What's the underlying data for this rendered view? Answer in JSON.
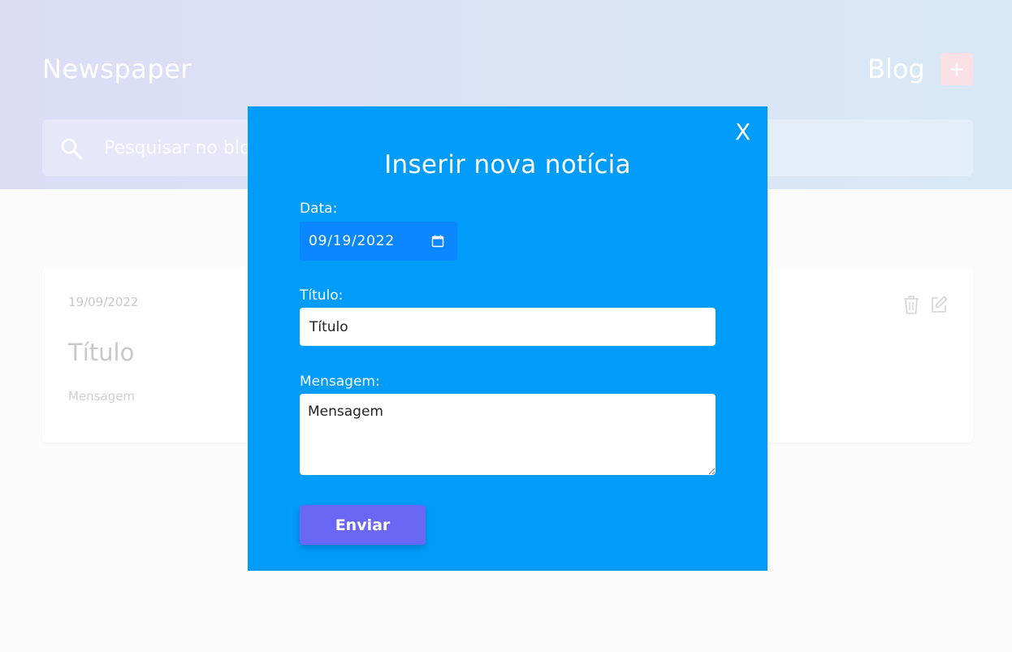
{
  "header": {
    "brand": "Newspaper",
    "blog_title": "Blog",
    "add_label": "+",
    "search_placeholder": "Pesquisar no blog"
  },
  "card": {
    "date": "19/09/2022",
    "title": "Título",
    "message": "Mensagem"
  },
  "modal": {
    "close_label": "X",
    "title": "Inserir nova notícia",
    "date_label": "Data:",
    "date_value": "09/19/2022",
    "title_label": "Título:",
    "title_value": "Título",
    "message_label": "Mensagem:",
    "message_value": "Mensagem",
    "submit_label": "Enviar"
  },
  "colors": {
    "modal_bg": "#009cfa",
    "date_field_bg": "#0a86ff",
    "submit_bg": "#6a67f4",
    "add_button_bg": "#fbe0e6"
  },
  "icons": {
    "search": "search-icon",
    "trash": "trash-icon",
    "edit": "edit-icon",
    "calendar": "calendar-icon"
  }
}
